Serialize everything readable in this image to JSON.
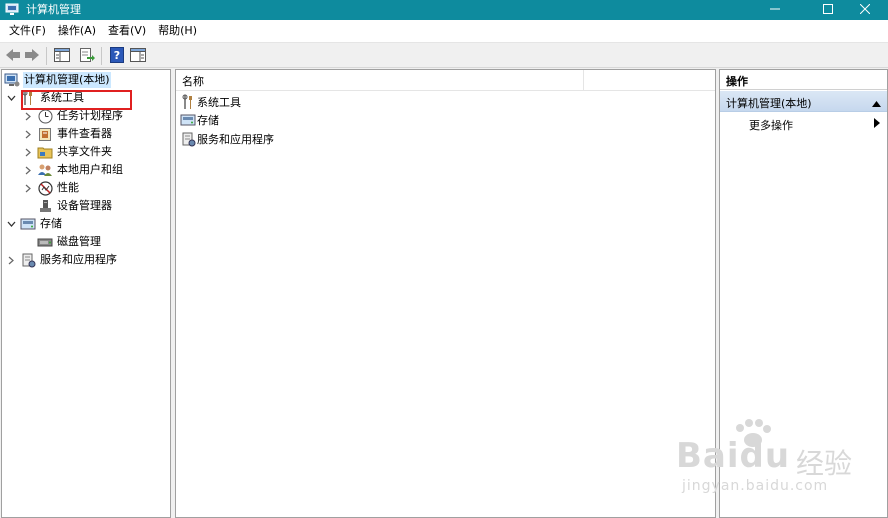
{
  "window": {
    "title": "计算机管理",
    "minimize_icon": "minimize-icon",
    "maximize_icon": "maximize-icon",
    "close_icon": "close-icon"
  },
  "menu": [
    {
      "label": "文件(F)"
    },
    {
      "label": "操作(A)"
    },
    {
      "label": "查看(V)"
    },
    {
      "label": "帮助(H)"
    }
  ],
  "toolbar": {
    "icons": [
      "back-arrow-icon",
      "forward-arrow-icon",
      "show-hide-console-tree-icon",
      "export-list-icon",
      "help-icon",
      "show-hide-action-pane-icon"
    ]
  },
  "tree": {
    "root": "计算机管理(本地)",
    "system_tools": "系统工具",
    "task_scheduler": "任务计划程序",
    "event_viewer": "事件查看器",
    "shared_folders": "共享文件夹",
    "local_users": "本地用户和组",
    "performance": "性能",
    "device_manager": "设备管理器",
    "storage": "存储",
    "disk_management": "磁盘管理",
    "services_apps": "服务和应用程序"
  },
  "center": {
    "column_name": "名称",
    "items": [
      {
        "label": "系统工具"
      },
      {
        "label": "存储"
      },
      {
        "label": "服务和应用程序"
      }
    ]
  },
  "actions": {
    "header": "操作",
    "section": "计算机管理(本地)",
    "more": "更多操作"
  },
  "watermark": {
    "brand": "Baidu",
    "cn": "经验",
    "url": "jingyan.baidu.com"
  },
  "colors": {
    "titlebar": "#0e8b9e",
    "selection": "#cce8ff",
    "highlight": "#e02020"
  }
}
